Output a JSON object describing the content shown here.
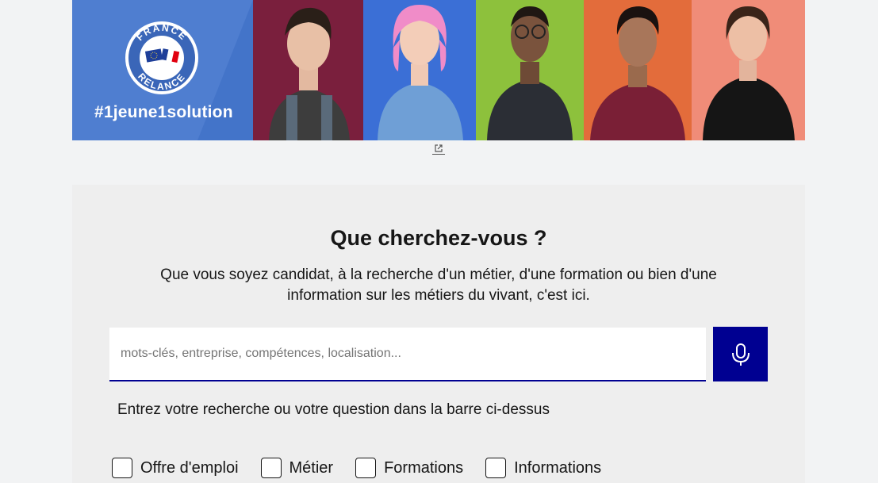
{
  "banner": {
    "hashtag": "#1jeune1solution",
    "seal_top_text": "FRANCE",
    "seal_bottom_text": "RELANCE",
    "panels": [
      {
        "color": "#7a1f3d",
        "shirt": "#3d3d3d"
      },
      {
        "color": "#3b6fd6",
        "shirt": "#6f9fd6"
      },
      {
        "color": "#8dc13c",
        "shirt": "#2b2e35"
      },
      {
        "color": "#e36c3b",
        "shirt": "#7a1f36"
      },
      {
        "color": "#f08c78",
        "shirt": "#151515"
      }
    ],
    "external_link_icon": "external-link-icon"
  },
  "search": {
    "title": "Que cherchez-vous ?",
    "description": "Que vous soyez candidat, à la recherche d'un métier, d'une formation ou bien d'une information sur les métiers du vivant, c'est ici.",
    "placeholder": "mots-clés, entreprise, compétences, localisation...",
    "value": "",
    "mic_icon": "microphone-icon",
    "hint": "Entrez votre recherche ou votre question dans la barre ci-dessus",
    "filters": [
      "Offre d'emploi",
      "Métier",
      "Formations",
      "Informations"
    ]
  },
  "colors": {
    "accent": "#000091",
    "page_bg": "#f2f3f4",
    "card_bg": "#eeeeee",
    "brand_blue": "#4f7ed0"
  }
}
